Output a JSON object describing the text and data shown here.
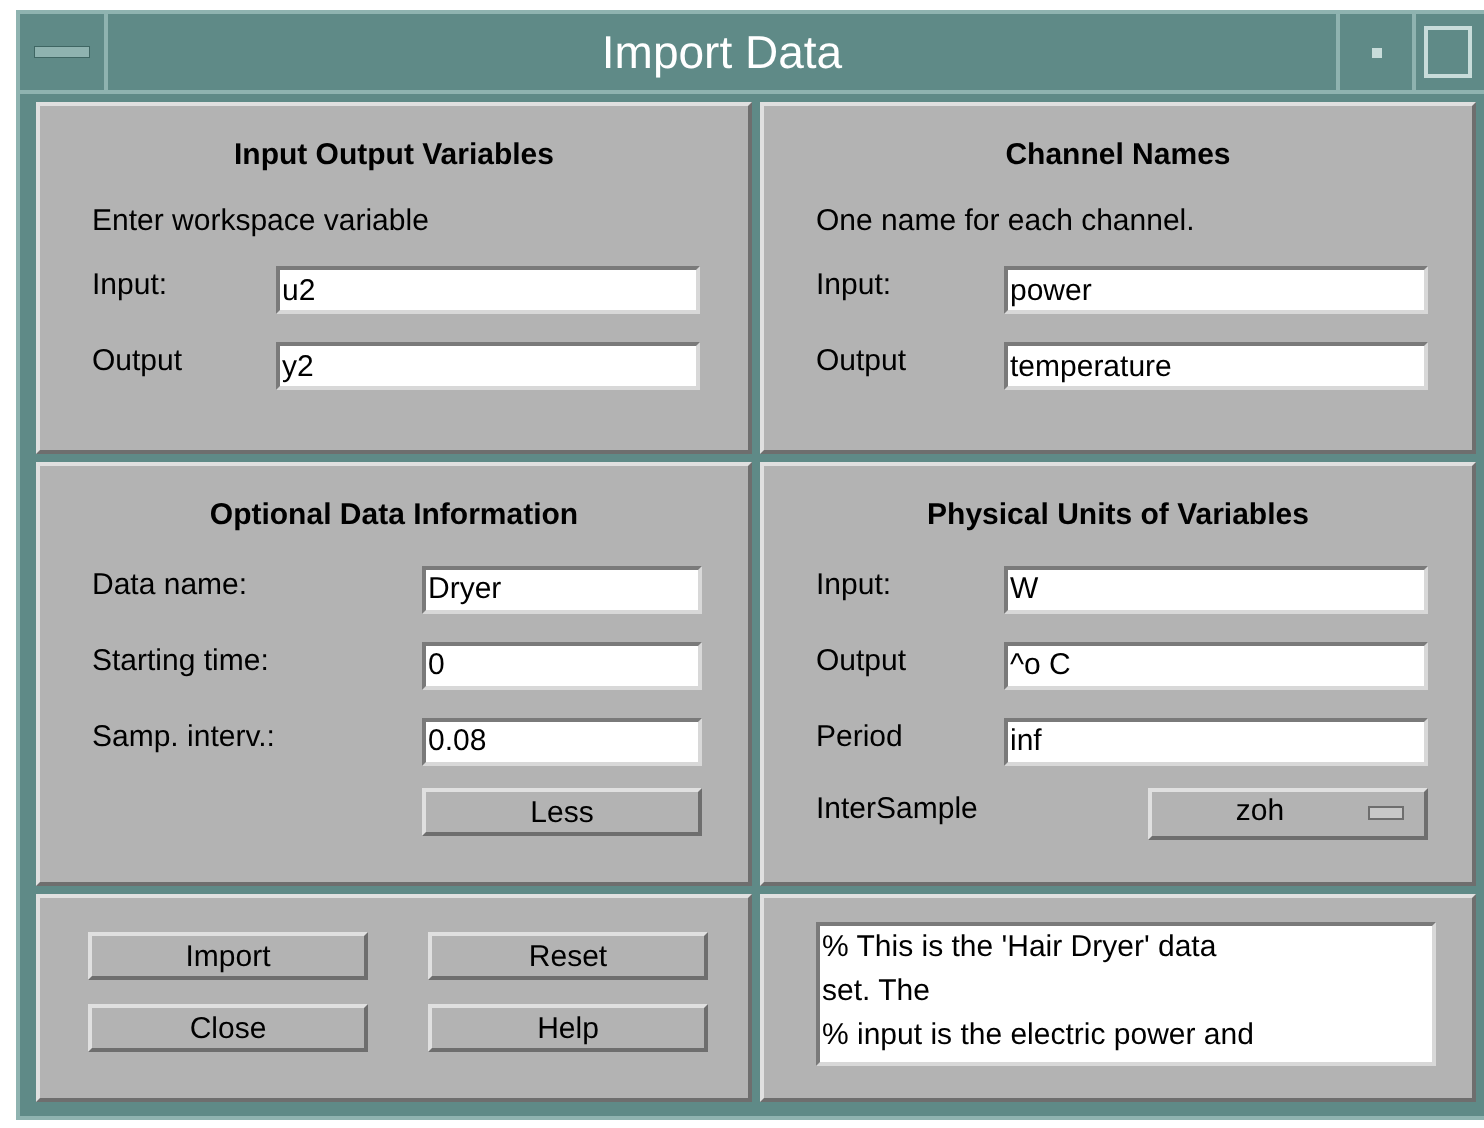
{
  "window": {
    "title": "Import Data"
  },
  "io_variables": {
    "title": "Input Output Variables",
    "hint": "Enter workspace variable",
    "fields": [
      {
        "label": "Input:",
        "value": "u2"
      },
      {
        "label": "Output",
        "value": "y2"
      }
    ]
  },
  "channel_names": {
    "title": "Channel Names",
    "hint": "One name for each channel.",
    "fields": [
      {
        "label": "Input:",
        "value": "power"
      },
      {
        "label": "Output",
        "value": "temperature"
      }
    ]
  },
  "data_info": {
    "title": "Optional Data Information",
    "fields": [
      {
        "label": "Data name:",
        "value": "Dryer"
      },
      {
        "label": "Starting time:",
        "value": "0"
      },
      {
        "label": "Samp. interv.:",
        "value": "0.08"
      }
    ],
    "button": "Less"
  },
  "units": {
    "title": "Physical Units of Variables",
    "fields": [
      {
        "label": "Input:",
        "value": "W"
      },
      {
        "label": "Output",
        "value": "^o C"
      },
      {
        "label": "Period",
        "value": "inf"
      }
    ],
    "intersample": {
      "label": "InterSample",
      "value": "zoh"
    }
  },
  "buttons": [
    "Import",
    "Reset",
    "Close",
    "Help"
  ],
  "notes": [
    "% This is the 'Hair Dryer' data",
    "set. The",
    "% input is the electric power and"
  ]
}
